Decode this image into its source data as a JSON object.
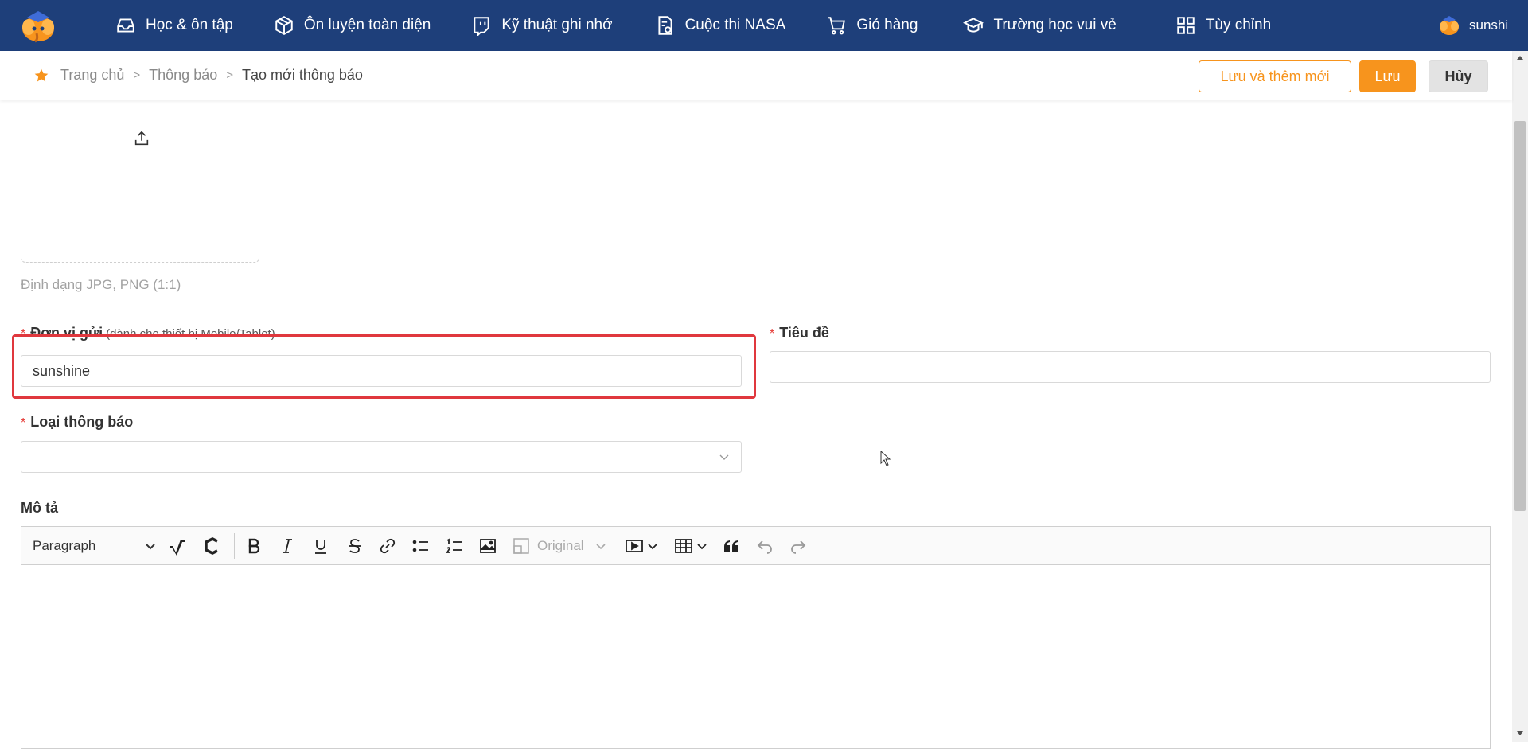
{
  "nav": {
    "items": [
      {
        "label": "Học & ôn tập",
        "icon": "inbox-icon"
      },
      {
        "label": "Ôn luyện toàn diện",
        "icon": "cube-icon"
      },
      {
        "label": "Kỹ thuật ghi nhớ",
        "icon": "twitch-icon"
      },
      {
        "label": "Cuộc thi NASA",
        "icon": "document-icon"
      },
      {
        "label": "Giỏ hàng",
        "icon": "cart-icon"
      },
      {
        "label": "Trường học vui vẻ",
        "icon": "graduation-cap-icon"
      },
      {
        "label": "Tùy chỉnh",
        "icon": "grid-icon"
      }
    ],
    "user": "sunshi"
  },
  "breadcrumb": {
    "home": "Trang chủ",
    "section": "Thông báo",
    "current": "Tạo mới thông báo",
    "separator": ">"
  },
  "actions": {
    "save_and_new": "Lưu và thêm mới",
    "save": "Lưu",
    "cancel": "Hủy"
  },
  "upload": {
    "hint": "Định dạng JPG, PNG (1:1)"
  },
  "form": {
    "sender": {
      "label": "Đơn vị gửi",
      "sublabel": "(dành cho thiết bị Mobile/Tablet)",
      "value": "sunshine"
    },
    "title": {
      "label": "Tiêu đề",
      "value": ""
    },
    "type": {
      "label": "Loại thông báo",
      "value": ""
    },
    "description": {
      "label": "Mô tả"
    },
    "required_mark": "*"
  },
  "editor": {
    "paragraph": "Paragraph",
    "image_size": "Original"
  },
  "colors": {
    "nav_bg": "#1e3f7a",
    "accent": "#f7941d",
    "highlight": "#e0383e",
    "required": "#e53935"
  }
}
